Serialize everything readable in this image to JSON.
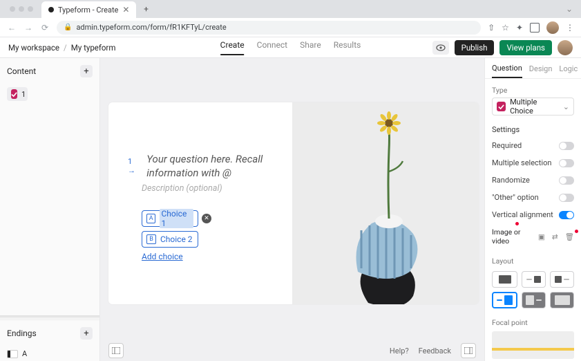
{
  "browser": {
    "tab_title": "Typeform - Create",
    "url": "admin.typeform.com/form/fR1KFTyL/create",
    "actions": {
      "share": "⇧",
      "star": "☆",
      "ext": "✦",
      "sidebar": "▣",
      "menu": "⋮"
    }
  },
  "breadcrumbs": {
    "workspace": "My workspace",
    "form": "My typeform"
  },
  "header_tabs": {
    "create": "Create",
    "connect": "Connect",
    "share": "Share",
    "results": "Results"
  },
  "header_buttons": {
    "publish": "Publish",
    "view_plans": "View plans"
  },
  "sidebar": {
    "content_label": "Content",
    "question_number": "1",
    "endings_label": "Endings",
    "ending_key": "A"
  },
  "question": {
    "number_prefix": "1 →",
    "placeholder": "Your question here. Recall information with @",
    "description_placeholder": "Description (optional)",
    "choices": [
      {
        "key": "A",
        "label": "Choice 1",
        "selected": true
      },
      {
        "key": "B",
        "label": "Choice 2",
        "selected": false
      }
    ],
    "add_choice": "Add choice"
  },
  "footer": {
    "help": "Help?",
    "feedback": "Feedback"
  },
  "panel": {
    "tabs": {
      "question": "Question",
      "design": "Design",
      "logic": "Logic"
    },
    "type_label": "Type",
    "type_value": "Multiple Choice",
    "settings_label": "Settings",
    "settings": {
      "required": "Required",
      "multiple_selection": "Multiple selection",
      "randomize": "Randomize",
      "other_option": "\"Other\" option",
      "vertical_alignment": "Vertical alignment"
    },
    "media_label": "Image or video",
    "layout_label": "Layout",
    "focal_label": "Focal point"
  },
  "colors": {
    "accent": "#c4225f",
    "link": "#2a6ad3",
    "green": "#0a8754",
    "toggle_on": "#0a84ff"
  }
}
